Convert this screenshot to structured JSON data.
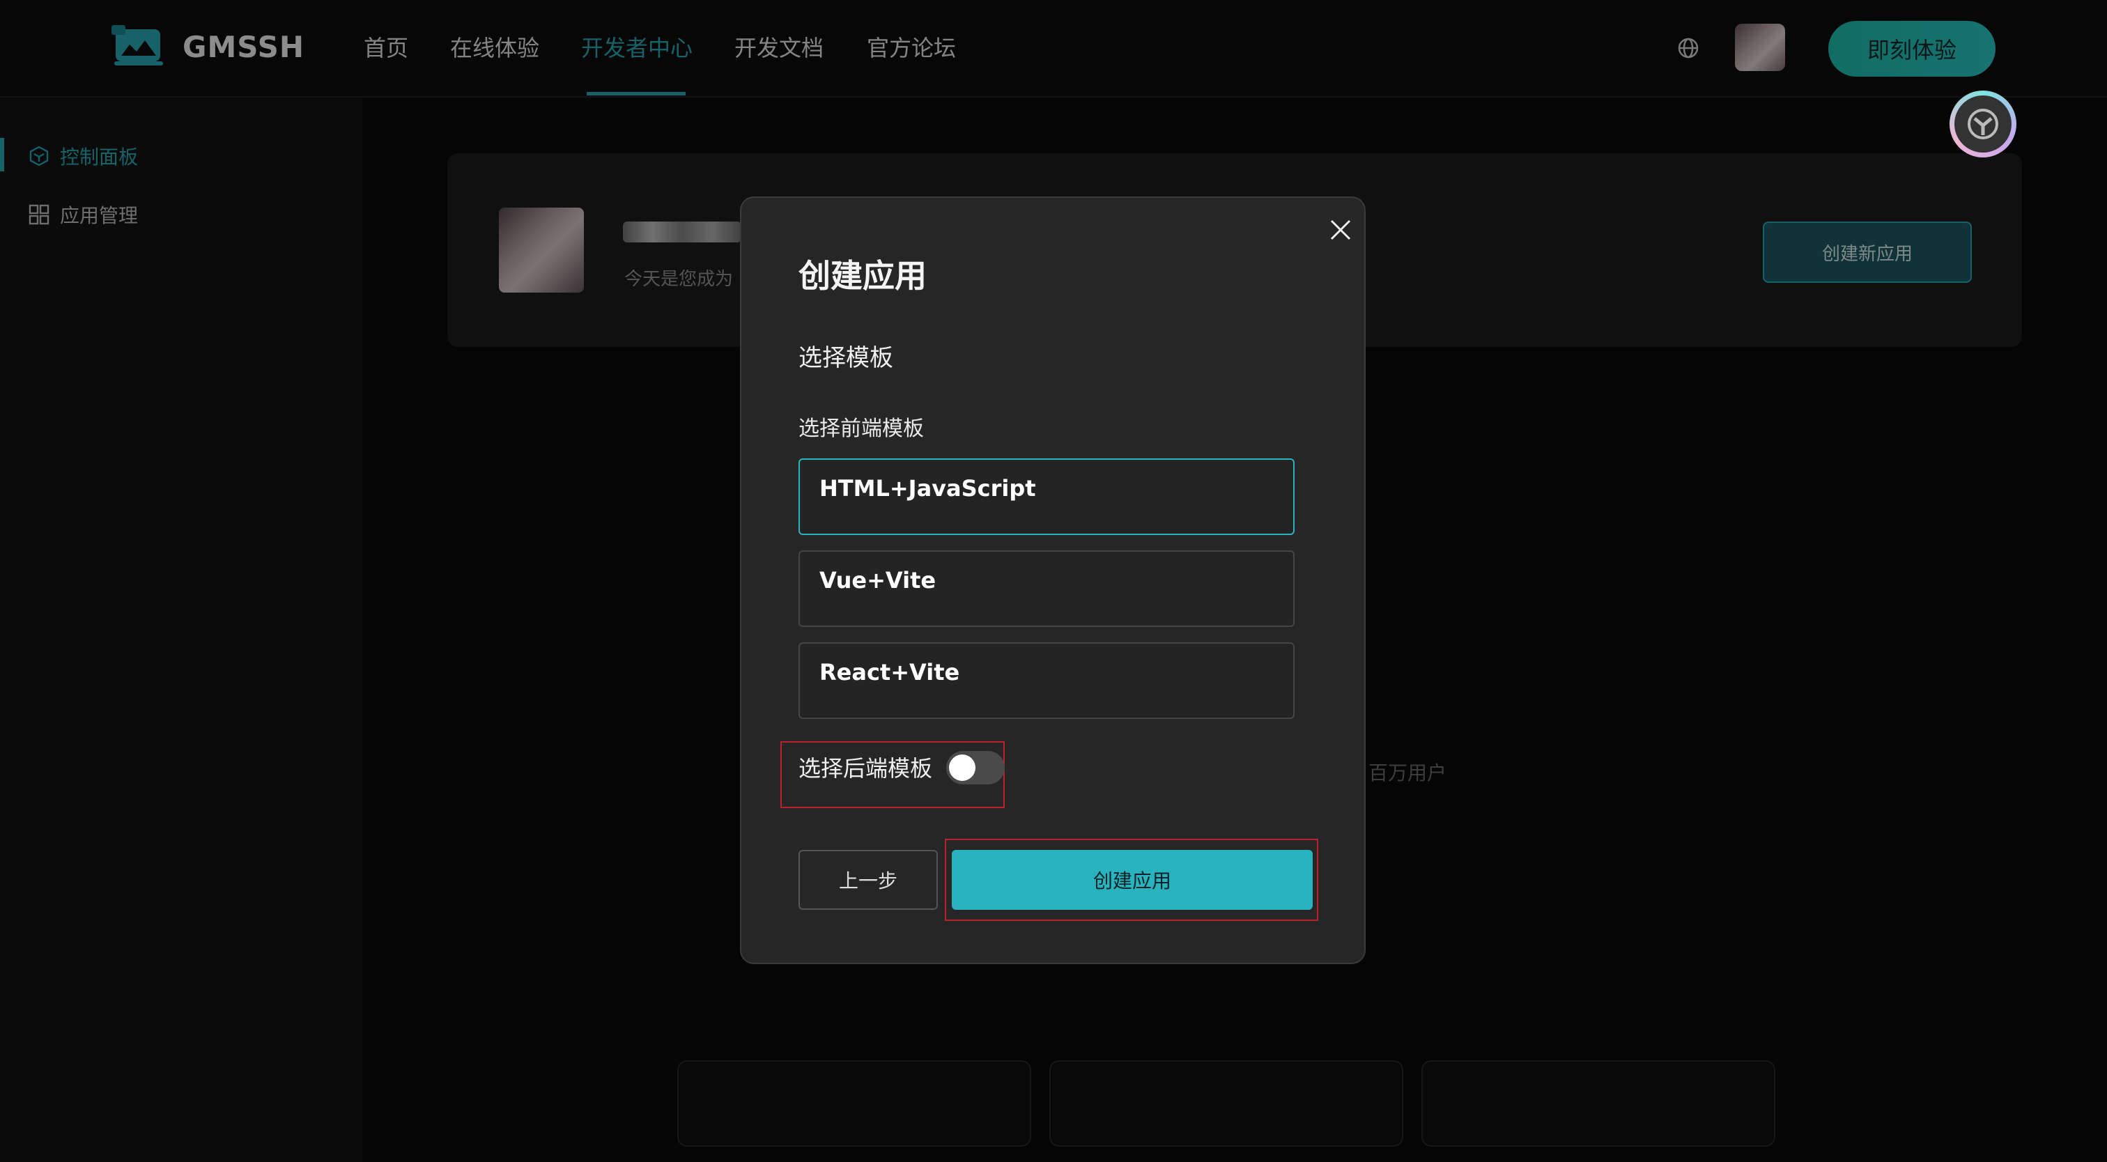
{
  "brand": {
    "name": "GMSSH"
  },
  "nav": {
    "items": [
      {
        "label": "首页"
      },
      {
        "label": "在线体验"
      },
      {
        "label": "开发者中心"
      },
      {
        "label": "开发文档"
      },
      {
        "label": "官方论坛"
      }
    ],
    "active_index": 2,
    "cta_label": "即刻体验"
  },
  "sidebar": {
    "items": [
      {
        "label": "控制面板",
        "icon": "cube-icon",
        "active": true
      },
      {
        "label": "应用管理",
        "icon": "grid-icon",
        "active": false
      }
    ]
  },
  "dashboard": {
    "subtitle": "今天是您成为",
    "create_new_label": "创建新应用",
    "users_text": "百万用户"
  },
  "modal": {
    "title": "创建应用",
    "section_title": "选择模板",
    "frontend_label": "选择前端模板",
    "templates": [
      {
        "label": "HTML+JavaScript",
        "selected": true
      },
      {
        "label": "Vue+Vite",
        "selected": false
      },
      {
        "label": "React+Vite",
        "selected": false
      }
    ],
    "backend_label": "选择后端模板",
    "backend_enabled": false,
    "prev_label": "上一步",
    "create_label": "创建应用"
  },
  "colors": {
    "accent": "#2bb3bf",
    "highlight": "#b8232c"
  }
}
